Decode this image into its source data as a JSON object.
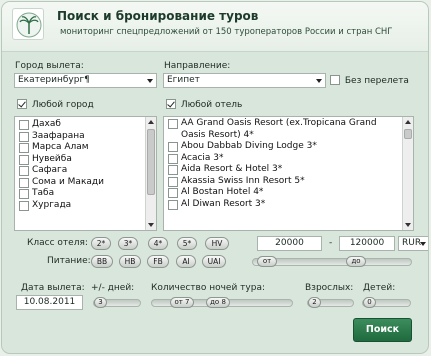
{
  "header": {
    "title": "Поиск и бронирование туров",
    "subtitle": "мониторинг спецпредложений от 150 туроператоров России и стран СНГ"
  },
  "departure": {
    "label": "Город вылета:",
    "value": "Екатеринбург¶"
  },
  "destination": {
    "label": "Направление:",
    "value": "Египет"
  },
  "no_flight_label": "Без перелета",
  "any_city_label": "Любой город",
  "any_hotel_label": "Любой отель",
  "cities": [
    "Дахаб",
    "Заафарана",
    "Марса Алам",
    "Нувейба",
    "Сафага",
    "Сома и Макади",
    "Таба",
    "Хургада"
  ],
  "hotels": [
    "AA Grand Oasis Resort (ex.Tropicana Grand Oasis Resort) 4*",
    "Abou Dabbab Diving Lodge 3*",
    "Acacia 3*",
    "Aida Resort & Hotel 3*",
    "Akassia Swiss Inn Resort 5*",
    "Al Bostan Hotel 4*",
    "Al Diwan Resort 3*"
  ],
  "hotel_class": {
    "label": "Класс отеля:",
    "options": [
      "2*",
      "3*",
      "4*",
      "5*",
      "HV"
    ]
  },
  "price": {
    "from": "20000",
    "dash": "-",
    "to": "120000",
    "currency": "RUR"
  },
  "meal": {
    "label": "Питание:",
    "options": [
      "BB",
      "HB",
      "FB",
      "AI",
      "UAI"
    ],
    "from_label": "от",
    "to_label": "до"
  },
  "date": {
    "label": "Дата вылета:",
    "value": "10.08.2011"
  },
  "plus_minus": {
    "label": "+/- дней:",
    "value": "3"
  },
  "nights": {
    "label": "Количество ночей тура:",
    "from": "от 7",
    "to": "до 8"
  },
  "adults": {
    "label": "Взрослых:",
    "value": "2"
  },
  "children": {
    "label": "Детей:",
    "value": "0"
  },
  "search_label": "Поиск",
  "colors": {
    "accent": "#2a7a4b",
    "panel": "#d9e6dc"
  }
}
